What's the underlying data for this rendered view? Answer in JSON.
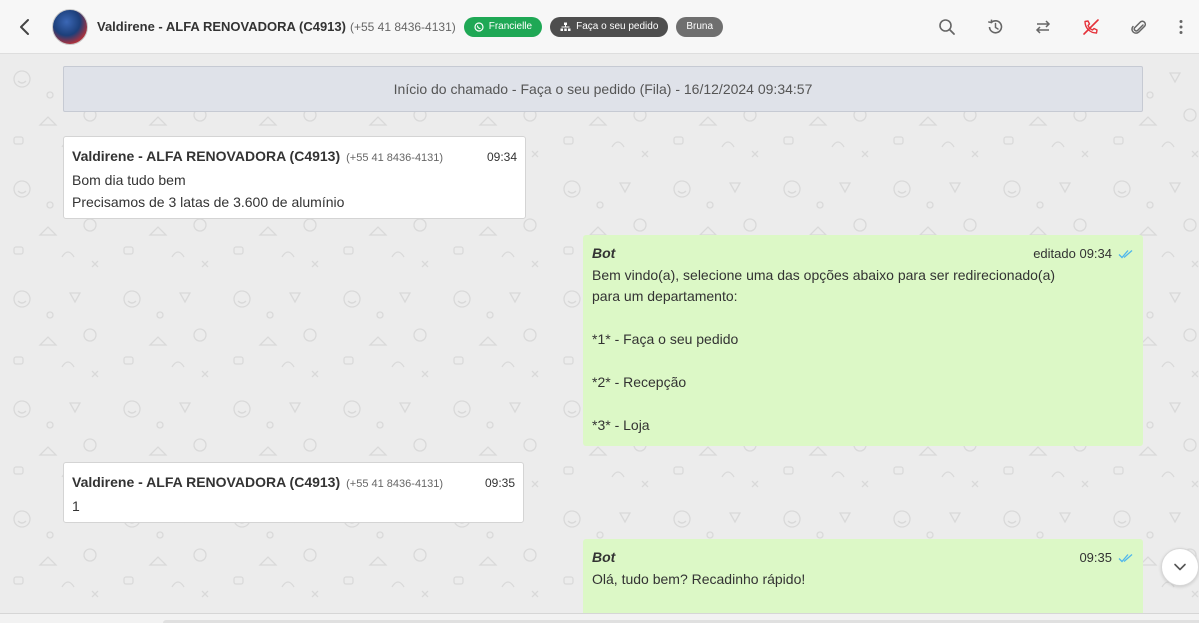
{
  "header": {
    "contact_name": "Valdirene - ALFA RENOVADORA (C4913)",
    "contact_phone": "(+55 41 8436-4131)",
    "tags": [
      {
        "label": "Francielle",
        "icon": "whatsapp-icon",
        "color": "#1fa855"
      },
      {
        "label": "Faça o seu pedido",
        "icon": "sitemap-icon",
        "color": "#4e4e4e"
      },
      {
        "label": "Bruna",
        "icon": "",
        "color": "#6f6f6f"
      }
    ],
    "tools": [
      "search-icon",
      "history-icon",
      "transfer-icon",
      "end-call-icon",
      "paperclip-icon",
      "more-vertical-icon"
    ]
  },
  "banner": {
    "text": "Início do chamado - Faça o seu pedido (Fila) - 16/12/2024 09:34:57"
  },
  "messages": [
    {
      "author": "Valdirene - ALFA RENOVADORA (C4913)",
      "phone": "(+55 41 8436-4131)",
      "time": "09:34",
      "lines": [
        "Bom dia tudo bem",
        "Precisamos de 3 latas de 3.600 de alumínio"
      ]
    },
    {
      "author": "Bot",
      "meta": "editado 09:34",
      "lines": [
        "Bem vindo(a), selecione uma das opções abaixo para ser redirecionado(a)",
        "para um departamento:",
        "",
        "*1* - Faça o seu pedido",
        "",
        "*2* - Recepção",
        "",
        "*3* - Loja"
      ]
    },
    {
      "author": "Valdirene - ALFA RENOVADORA (C4913)",
      "phone": "(+55 41 8436-4131)",
      "time": "09:35",
      "lines": [
        "1"
      ]
    },
    {
      "author": "Bot",
      "meta": "09:35",
      "lines": [
        "Olá, tudo bem? Recadinho rápido!"
      ]
    }
  ],
  "colors": {
    "outgoing_bubble": "#dcf8c6",
    "incoming_bubble": "#ffffff",
    "read_ticks": "#4fb6ec",
    "end_call_icon": "#e5323b"
  }
}
